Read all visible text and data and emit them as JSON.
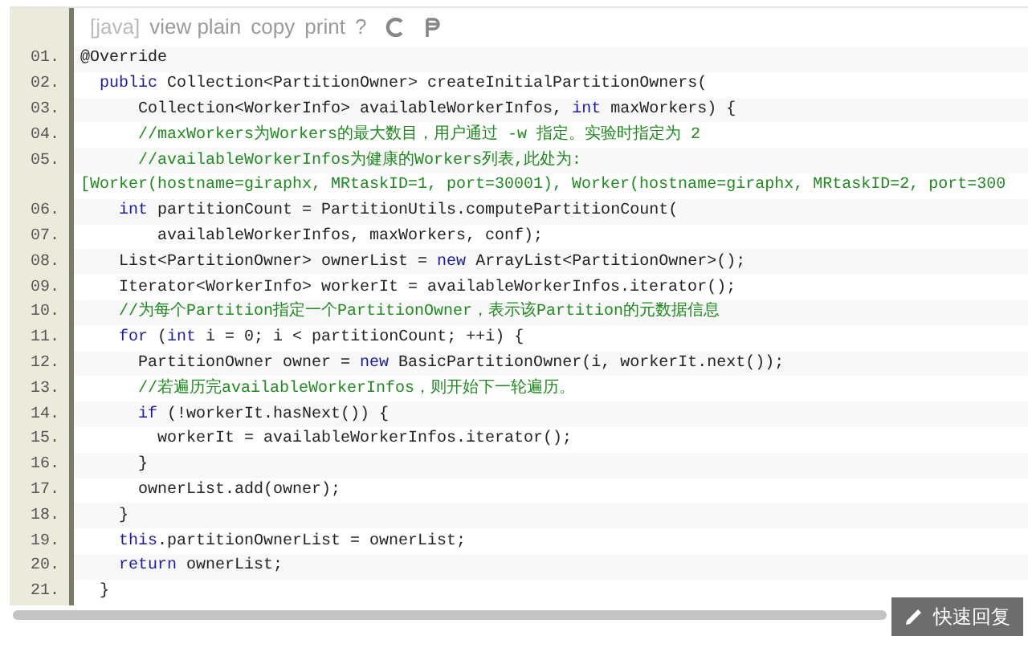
{
  "toolbar": {
    "language": "[java]",
    "links": [
      "view plain",
      "copy",
      "print",
      "?"
    ]
  },
  "lines": [
    {
      "number": "01.",
      "tokens": [
        {
          "kind": "plain",
          "text": "@Override"
        }
      ]
    },
    {
      "number": "02.",
      "tokens": [
        {
          "kind": "keyword",
          "text": "  public"
        },
        {
          "kind": "plain",
          "text": " Collection<PartitionOwner> createInitialPartitionOwners("
        }
      ]
    },
    {
      "number": "03.",
      "tokens": [
        {
          "kind": "plain",
          "text": "      Collection<WorkerInfo> availableWorkerInfos, "
        },
        {
          "kind": "keyword",
          "text": "int"
        },
        {
          "kind": "plain",
          "text": " maxWorkers) {"
        }
      ]
    },
    {
      "number": "04.",
      "tokens": [
        {
          "kind": "comment",
          "text": "      //maxWorkers为Workers的最大数目，用户通过 -w 指定。实验时指定为 2"
        }
      ]
    },
    {
      "number": "05.",
      "tokens": [
        {
          "kind": "comment",
          "text": "      //availableWorkerInfos为健康的Workers列表,此处为:"
        }
      ],
      "wrapped": [
        {
          "kind": "comment",
          "text": "[Worker(hostname=giraphx, MRtaskID=1, port=30001), Worker(hostname=giraphx, MRtaskID=2, port=300"
        }
      ]
    },
    {
      "number": "06.",
      "tokens": [
        {
          "kind": "keyword",
          "text": "    int"
        },
        {
          "kind": "plain",
          "text": " partitionCount = PartitionUtils.computePartitionCount("
        }
      ]
    },
    {
      "number": "07.",
      "tokens": [
        {
          "kind": "plain",
          "text": "        availableWorkerInfos, maxWorkers, conf);"
        }
      ]
    },
    {
      "number": "08.",
      "tokens": [
        {
          "kind": "plain",
          "text": "    List<PartitionOwner> ownerList = "
        },
        {
          "kind": "keyword",
          "text": "new"
        },
        {
          "kind": "plain",
          "text": " ArrayList<PartitionOwner>();"
        }
      ]
    },
    {
      "number": "09.",
      "tokens": [
        {
          "kind": "plain",
          "text": "    Iterator<WorkerInfo> workerIt = availableWorkerInfos.iterator();"
        }
      ]
    },
    {
      "number": "10.",
      "tokens": [
        {
          "kind": "comment",
          "text": "    //为每个Partition指定一个PartitionOwner，表示该Partition的元数据信息"
        }
      ]
    },
    {
      "number": "11.",
      "tokens": [
        {
          "kind": "keyword",
          "text": "    for"
        },
        {
          "kind": "plain",
          "text": " ("
        },
        {
          "kind": "keyword",
          "text": "int"
        },
        {
          "kind": "plain",
          "text": " i = 0; i < partitionCount; ++i) {"
        }
      ]
    },
    {
      "number": "12.",
      "tokens": [
        {
          "kind": "plain",
          "text": "      PartitionOwner owner = "
        },
        {
          "kind": "keyword",
          "text": "new"
        },
        {
          "kind": "plain",
          "text": " BasicPartitionOwner(i, workerIt.next());"
        }
      ]
    },
    {
      "number": "13.",
      "tokens": [
        {
          "kind": "comment",
          "text": "      //若遍历完availableWorkerInfos，则开始下一轮遍历。"
        }
      ]
    },
    {
      "number": "14.",
      "tokens": [
        {
          "kind": "keyword",
          "text": "      if"
        },
        {
          "kind": "plain",
          "text": " (!workerIt.hasNext()) {"
        }
      ]
    },
    {
      "number": "15.",
      "tokens": [
        {
          "kind": "plain",
          "text": "        workerIt = availableWorkerInfos.iterator();"
        }
      ]
    },
    {
      "number": "16.",
      "tokens": [
        {
          "kind": "plain",
          "text": "      }"
        }
      ]
    },
    {
      "number": "17.",
      "tokens": [
        {
          "kind": "plain",
          "text": "      ownerList.add(owner);"
        }
      ]
    },
    {
      "number": "18.",
      "tokens": [
        {
          "kind": "plain",
          "text": "    }"
        }
      ]
    },
    {
      "number": "19.",
      "tokens": [
        {
          "kind": "keyword",
          "text": "    this"
        },
        {
          "kind": "plain",
          "text": ".partitionOwnerList = ownerList;"
        }
      ]
    },
    {
      "number": "20.",
      "tokens": [
        {
          "kind": "keyword",
          "text": "    return"
        },
        {
          "kind": "plain",
          "text": " ownerList;"
        }
      ]
    },
    {
      "number": "21.",
      "tokens": [
        {
          "kind": "plain",
          "text": "  }"
        }
      ]
    }
  ],
  "reply_button": {
    "label": "快速回复"
  }
}
